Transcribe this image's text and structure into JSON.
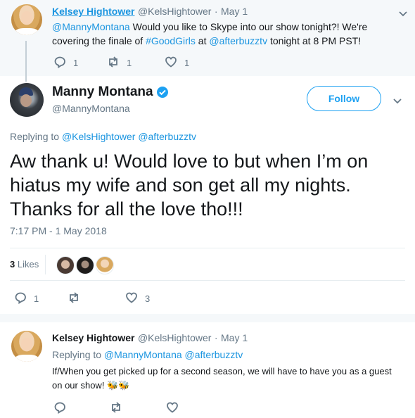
{
  "parent_tweet": {
    "name": "Kelsey Hightower",
    "handle": "@KelsHightower",
    "dot": "·",
    "date": "May 1",
    "text_mention": "@MannyMontana",
    "text_part1": " Would you like to Skype into our show tonight?! We're covering the finale of ",
    "text_hashtag": "#GoodGirls",
    "text_part2": " at ",
    "text_mention2": "@afterbuzztv",
    "text_part3": " tonight at 8 PM PST!",
    "reply_count": "1",
    "retweet_count": "1",
    "like_count": "1"
  },
  "main_tweet": {
    "name": "Manny Montana",
    "handle": "@MannyMontana",
    "follow_label": "Follow",
    "replying_prefix": "Replying to ",
    "replying_to_1": "@KelsHightower",
    "replying_to_2": "@afterbuzztv",
    "text": "Aw thank u! Would love to but when I’m on hiatus my wife and son get all my nights. Thanks for all the love tho!!!",
    "timestamp": "7:17 PM - 1 May 2018",
    "likes_count": "3",
    "likes_label": "Likes",
    "reply_count": "1",
    "retweet_count": "",
    "like_count": "3"
  },
  "reply_tweet": {
    "name": "Kelsey Hightower",
    "handle": "@KelsHightower",
    "dot": "·",
    "date": "May 1",
    "replying_prefix": "Replying to ",
    "replying_to_1": "@MannyMontana",
    "replying_to_2": "@afterbuzztv",
    "text": "If/When you get picked up for a second season, we will have to have you as a guest on our show! ",
    "emoji": "🐝🐝"
  },
  "colors": {
    "link": "#1b95e0",
    "follow": "#1da1f2",
    "verified": "#1da1f2",
    "muted": "#657786",
    "parent_bg": "#f5f8fa"
  },
  "icons": {
    "reply": "reply-icon",
    "retweet": "retweet-icon",
    "like": "heart-icon",
    "menu": "chevron-down-icon",
    "verified": "verified-badge-icon"
  }
}
